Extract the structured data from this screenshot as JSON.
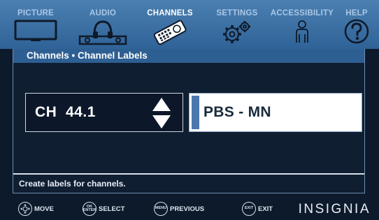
{
  "menu": {
    "items": [
      {
        "label": "PICTURE",
        "icon": "tv-icon",
        "active": false
      },
      {
        "label": "AUDIO",
        "icon": "headphones-icon",
        "active": false
      },
      {
        "label": "CHANNELS",
        "icon": "remote-control-icon",
        "active": true
      },
      {
        "label": "SETTINGS",
        "icon": "gears-icon",
        "active": false
      },
      {
        "label": "ACCESSIBILITY",
        "icon": "person-icon",
        "active": false
      },
      {
        "label": "HELP",
        "icon": "question-mark-icon",
        "active": false
      }
    ]
  },
  "breadcrumb": "Channels • Channel Labels",
  "channel": {
    "value": "CH  44.1",
    "control_icon": "up-down-arrows-icon"
  },
  "label_field": {
    "value": "PBS - MN",
    "cursor_char": "P"
  },
  "hint": "Create labels for channels.",
  "help_bar": [
    {
      "icon_text": "",
      "label": "MOVE",
      "icon": "dpad-icon"
    },
    {
      "icon_text": "OK ENTER",
      "label": "SELECT",
      "icon": "ok-enter-button-icon"
    },
    {
      "icon_text": "MENU",
      "label": "PREVIOUS",
      "icon": "menu-button-icon"
    },
    {
      "icon_text": "EXIT",
      "label": "EXIT",
      "icon": "exit-button-icon"
    }
  ],
  "brand": "INSIGNIA",
  "colors": {
    "topbar": "#3f73a6",
    "background": "#0d1a2b",
    "breadcrumb_bar": "#2e5f93",
    "cursor": "#4a78ad",
    "inactive_menu_text": "#a9c7e6"
  }
}
